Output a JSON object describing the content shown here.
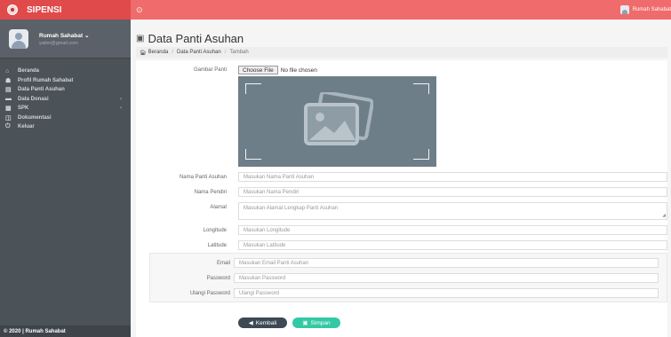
{
  "app": {
    "name": "SIPENSI",
    "footer": "© 2020 | Rumah Sahabat"
  },
  "user": {
    "name": "Rumah Sahabat",
    "email": "yatim@gmail.com",
    "topbar_name": "Rumah Sahabat"
  },
  "sidebar": {
    "items": [
      {
        "icon": "⌂",
        "icon_name": "home-icon",
        "label": "Beranda"
      },
      {
        "icon": "☗",
        "icon_name": "user-icon",
        "label": "Profil Rumah Sahabat"
      },
      {
        "icon": "▤",
        "icon_name": "table-icon",
        "label": "Data Panti Asuhan"
      },
      {
        "icon": "▬",
        "icon_name": "card-icon",
        "label": "Data Donasi",
        "chevron": "‹"
      },
      {
        "icon": "▦",
        "icon_name": "calendar-icon",
        "label": "SPK",
        "chevron": "‹"
      },
      {
        "icon": "◫",
        "icon_name": "document-icon",
        "label": "Dokumentasi"
      },
      {
        "icon": "⏻",
        "icon_name": "power-icon",
        "label": "Keluar"
      }
    ]
  },
  "topbar": {
    "toggle_icon": "⊙"
  },
  "page": {
    "title": "Data Panti Asuhan",
    "title_icon": "▣"
  },
  "breadcrumb": {
    "home": "Beranda",
    "section": "Data Panti Asuhan",
    "current": "Tambah"
  },
  "form": {
    "image_label": "Gambar Panti",
    "file_button": "Choose File",
    "file_status": "No file chosen",
    "name_label": "Nama Panti Asuhan",
    "name_placeholder": "Masukan Nama Panti Asuhan",
    "founder_label": "Nama Pendiri",
    "founder_placeholder": "Masukan Nama Pendiri",
    "address_label": "Alamat",
    "address_placeholder": "Masukan Alamat Lengkap Panti Asuhan",
    "longitude_label": "Longitude",
    "longitude_placeholder": "Masukan Longitude",
    "latitude_label": "Latitude",
    "latitude_placeholder": "Masukan Latitude",
    "email_label": "Email",
    "email_placeholder": "Masukan Email Panti Asuhan",
    "password_label": "Password",
    "password_placeholder": "Masukan Password",
    "repassword_label": "Ulangi Password",
    "repassword_placeholder": "Ulangi Password",
    "back_button": "Kembali",
    "save_button": "Simpan"
  }
}
